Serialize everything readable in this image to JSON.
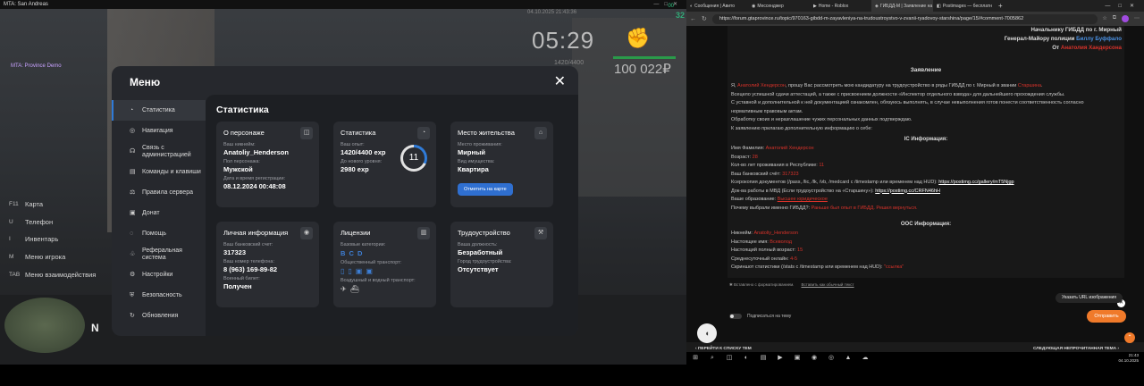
{
  "game": {
    "window_title": "MTA: San Andreas",
    "fps": "32",
    "fps_small": "00",
    "datetime": "04.10.2025 21:43:36",
    "clock": "05:29",
    "ammo": "1420/4400",
    "money": "100 022₽",
    "server": "MTA: Province Demo",
    "hotkeys": [
      {
        "key": "F11",
        "label": "Карта"
      },
      {
        "key": "U",
        "label": "Телефон"
      },
      {
        "key": "I",
        "label": "Инвентарь"
      },
      {
        "key": "M",
        "label": "Меню игрока"
      },
      {
        "key": "TAB",
        "label": "Меню взаимодействия"
      }
    ],
    "radar_north": "N"
  },
  "menu": {
    "title": "Меню",
    "close": "✕",
    "sidebar": [
      {
        "icon": "◔",
        "label": "Статистика"
      },
      {
        "icon": "◎",
        "label": "Навигация"
      },
      {
        "icon": "☊",
        "label": "Связь с администрацией"
      },
      {
        "icon": "▤",
        "label": "Команды и клавиши"
      },
      {
        "icon": "⚖",
        "label": "Правила сервера"
      },
      {
        "icon": "▣",
        "label": "Донат"
      },
      {
        "icon": "◌",
        "label": "Помощь"
      },
      {
        "icon": "♧",
        "label": "Реферальная система"
      },
      {
        "icon": "⚙",
        "label": "Настройки"
      },
      {
        "icon": "⛨",
        "label": "Безопасность"
      },
      {
        "icon": "↻",
        "label": "Обновления"
      }
    ],
    "content_title": "Статистика",
    "about": {
      "title": "О персонаже",
      "icon": "◫",
      "nick_label": "Ваш никнейм:",
      "nick": "Anatoliy_Henderson",
      "gender_label": "Пол персонажа:",
      "gender": "Мужской",
      "reg_label": "Дата и время регистрации:",
      "reg": "08.12.2024 00:48:08"
    },
    "stats": {
      "title": "Статистика",
      "icon": "◔",
      "exp_label": "Ваш опыт:",
      "exp": "1420/4400 exp",
      "next_label": "До нового уровня:",
      "next": "2980 exp",
      "level": "11",
      "level_progress": 0.32
    },
    "residence": {
      "title": "Место жительства",
      "icon": "⌂",
      "place_label": "Место проживания:",
      "place": "Мирный",
      "type_label": "Вид имущества:",
      "type": "Квартира",
      "button": "Отметить на карте"
    },
    "personal": {
      "title": "Личная информация",
      "icon": "◉",
      "bank_label": "Ваш банковский счет:",
      "bank": "317323",
      "phone_label": "Ваш номер телефона:",
      "phone": "8 (963) 169-89-82",
      "military_label": "Военный билет:",
      "military": "Получен"
    },
    "licenses": {
      "title": "Лицензии",
      "icon": "▥",
      "cat_label": "Базовые категории:",
      "cats": "B C D",
      "public_label": "Общественный транспорт:",
      "public_icons": "▯▯▣▣",
      "air_label": "Воздушный и водный транспорт:",
      "air_icons": "✈⛴"
    },
    "job": {
      "title": "Трудоустройство",
      "icon": "⚒",
      "pos_label": "Ваша должность:",
      "pos": "Безработный",
      "city_label": "Город трудоустройства:",
      "city": "Отсутствует"
    }
  },
  "browser": {
    "tabs": [
      {
        "icon": "◐",
        "label": "Сообщения | Авито"
      },
      {
        "icon": "◉",
        "label": "Мессенджер"
      },
      {
        "icon": "▶",
        "label": "Home - Roblox"
      },
      {
        "icon": "◈",
        "label": "ГИБДД-М | Заявление на"
      },
      {
        "icon": "◧",
        "label": "Postimages — бесплатн"
      }
    ],
    "url": "https://forum.gtaprovince.ru/topic/970163-gibdd-m-zayavleniya-na-trudoustroystvo-v-zvanii-ryadovoy-starshina/page/15/#comment-7005862",
    "post": {
      "to1_a": "Начальнику ",
      "to1_b": "ГИБДД по г. Мирный",
      "to2_a": "Генерал-Майору полиции ",
      "to2_b": "Биллу Буффало",
      "from_a": "От ",
      "from_b": "Анатолия Хандерсона",
      "heading": "Заявление",
      "p1_a": "Я, ",
      "p1_b": "Анатолий Хендерсон",
      "p1_c": ", прошу Вас рассмотреть мою кандидатуру на трудоустройство в ряды ГИБДД по г. Мирный в звании ",
      "p1_d": "Старшина",
      "p1_e": ".",
      "p2": "Всецело успешной сдачи аттестаций, а также с присвоением должности «Инспектор отдельного взвода» для дальнейшего прохождения службы.",
      "p3": "С уставной и дополнительной к ней документацией ознакомлен, обязуюсь выполнять, в случае невыполнения готов понести соответственность согласно",
      "p4": "нормативным правовым актам.",
      "p5": "Обработку своих и неразглашение чужих персональных данных подтверждаю.",
      "p6": "К заявлению прилагаю дополнительную информацию о себе:",
      "ic_heading": "IC Информация:",
      "ic1_a": "Имя Фамилия: ",
      "ic1_b": "Анатолий Хендерсон",
      "ic2_a": "Возраст: ",
      "ic2_b": "28",
      "ic3_a": "Кол-во лет проживания в Республике: ",
      "ic3_b": "11",
      "ic4_a": "Ваш банковский счёт: ",
      "ic4_b": "317323",
      "ic5_a": "Ксерокопия документов (/pass, /lic, /lk, /vb, /medcard с /timestamp или временем над HUD): ",
      "ic5_b": "https://postimg.cc/gallery/mT5Njgp",
      "ic6_a": "Док-ва работы в МВД (Если трудоустройство на «Старшину»): ",
      "ic6_b": "https://postimg.cc/CRFN46hH",
      "ic7_a": "Ваше образование: ",
      "ic7_b": "Высшее юридическое",
      "ic8_a": "Почему выбрали именно ГИБДД?: ",
      "ic8_b": "Раньше был опыт в ГИБДД. Решил вернуться.",
      "ooc_heading": "OOC Информация:",
      "ooc1_a": "Никнейм: ",
      "ooc1_b": "Anatoliy_Henderson",
      "ooc2_a": "Настоящее имя: ",
      "ooc2_b": "Всеволод",
      "ooc3_a": "Настоящий полный возраст: ",
      "ooc3_b": "15",
      "ooc4_a": "Среднесуточный онлайн: ",
      "ooc4_b": "4-5",
      "ooc5_a": "Скриншот статистики (/stats с /timestamp или временем над HUD): ",
      "ooc5_b": "\"ссылка\""
    },
    "editor_note": "Вставлено с форматированием.",
    "editor_plain": "Вставить как обычный текст",
    "url_button": "Указать URL изображения",
    "subscribe": "Подписаться на тему",
    "send": "Отправить",
    "prev": "ПЕРЕЙТИ К СПИСКУ ТЕМ",
    "next": "СЛЕДУЮЩАЯ НЕПРОЧИТАННАЯ ТЕМА",
    "close_x": "✕",
    "up": "⌃",
    "chat": "◖"
  },
  "taskbar": {
    "icons": [
      "⊞",
      "⌕",
      "◫",
      "◐",
      "▤",
      "▶",
      "▣",
      "◉",
      "◎",
      "▲",
      "☁"
    ],
    "time": "21:43",
    "date": "04.10.2025"
  }
}
